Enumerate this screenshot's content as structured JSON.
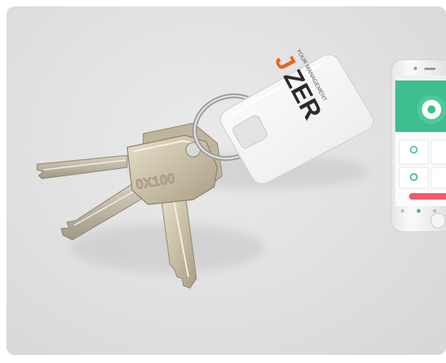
{
  "photo": {
    "kind": "product-photo",
    "colors": {
      "backdrop": "#e2e2e2",
      "tag": "#f7f7f5",
      "brand_orange": "#e8641e",
      "brand_dark": "#2b2b2b",
      "key_metal": "#c9bfa6",
      "ring_metal": "#a9a9a9",
      "phone_body": "#f4f4f4",
      "app_green": "#3dbf8e",
      "app_red": "#ef5b6b"
    },
    "tag": {
      "logo": "ZER",
      "logo_accent": "J",
      "tagline": "YOUR MANAGEMENT"
    },
    "key": {
      "engraving": "0X100"
    }
  }
}
